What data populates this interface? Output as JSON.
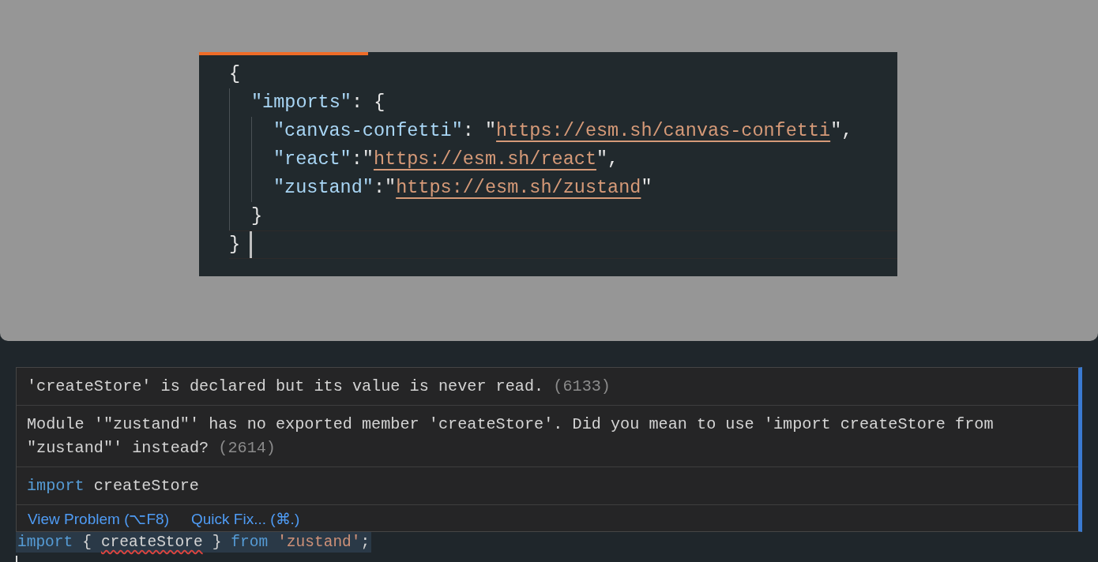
{
  "editor_tab": {
    "active": true
  },
  "code_lines": [
    [
      {
        "kind": "punct",
        "text": "{"
      }
    ],
    [
      {
        "kind": "key",
        "text": "\"imports\""
      },
      {
        "kind": "punct",
        "text": ": {"
      }
    ],
    [
      {
        "kind": "key",
        "text": "\"canvas-confetti\""
      },
      {
        "kind": "punct",
        "text": ": \""
      },
      {
        "kind": "url",
        "text": "https://esm.sh/canvas-confetti"
      },
      {
        "kind": "punct",
        "text": "\","
      }
    ],
    [
      {
        "kind": "key",
        "text": "\"react\""
      },
      {
        "kind": "punct",
        "text": ":\""
      },
      {
        "kind": "url",
        "text": "https://esm.sh/react"
      },
      {
        "kind": "punct",
        "text": "\","
      }
    ],
    [
      {
        "kind": "key",
        "text": "\"zustand\""
      },
      {
        "kind": "punct",
        "text": ":\""
      },
      {
        "kind": "url",
        "text": "https://esm.sh/zustand"
      },
      {
        "kind": "punct",
        "text": "\""
      }
    ],
    [
      {
        "kind": "punct",
        "text": "}"
      }
    ],
    [
      {
        "kind": "punct",
        "text": "}"
      }
    ]
  ],
  "hover": {
    "problems": [
      {
        "message": "'createStore' is declared but its value is never read.",
        "code": "(6133)"
      },
      {
        "message": "Module '\"zustand\"' has no exported member 'createStore'. Did you mean to use 'import createStore from \"zustand\"' instead?",
        "code": "(2614)"
      }
    ],
    "suggestion": [
      {
        "kind": "keyword",
        "text": "import"
      },
      {
        "kind": "plain",
        "text": "createStore"
      }
    ],
    "actions": [
      "View Problem (⌥F8)",
      "Quick Fix... (⌘.)"
    ]
  },
  "source_line": [
    {
      "kind": "keyword",
      "text": "import"
    },
    {
      "kind": "plain",
      "text": "{"
    },
    {
      "kind": "error",
      "text": "createStore"
    },
    {
      "kind": "plain",
      "text": "}"
    },
    {
      "kind": "keyword",
      "text": "from"
    },
    {
      "kind": "string",
      "text": "'zustand'"
    },
    {
      "kind": "terminator",
      "text": ";"
    }
  ]
}
